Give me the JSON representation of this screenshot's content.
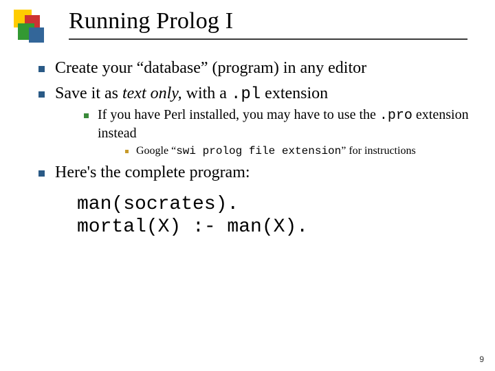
{
  "title": "Running Prolog I",
  "bullets": {
    "b1": {
      "pre": "Create your “database” (program) in any editor"
    },
    "b2": {
      "pre": "Save it as ",
      "ital": "text only,",
      "mid": " with a ",
      "code": ".pl",
      "post": " extension"
    },
    "b2a": {
      "pre": "If you have Perl installed, you may have to use the ",
      "code": ".pro",
      "post": " extension instead"
    },
    "b2a1": {
      "pre": "Google “",
      "code": "swi prolog file extension",
      "post": "” for instructions"
    },
    "b3": {
      "pre": "Here's the complete program:"
    }
  },
  "code": "man(socrates).\nmortal(X) :- man(X).",
  "pagenum": "9"
}
